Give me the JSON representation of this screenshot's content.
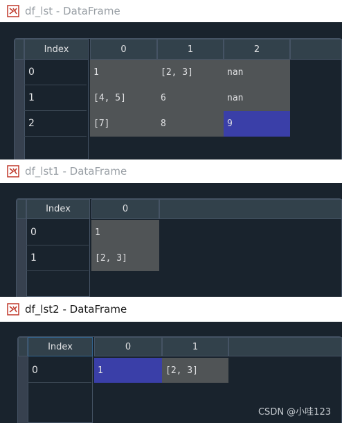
{
  "windows": [
    {
      "title": "df_lst - DataFrame",
      "index_header": "Index",
      "columns": [
        "0",
        "1",
        "2"
      ],
      "rows": [
        {
          "index": "0",
          "cells": [
            "1",
            "[2, 3]",
            "nan"
          ]
        },
        {
          "index": "1",
          "cells": [
            "[4, 5]",
            "6",
            "nan"
          ]
        },
        {
          "index": "2",
          "cells": [
            "[7]",
            "8",
            "9"
          ]
        }
      ],
      "selected_cell": "row 2, column 2"
    },
    {
      "title": "df_lst1 - DataFrame",
      "index_header": "Index",
      "columns": [
        "0"
      ],
      "rows": [
        {
          "index": "0",
          "cells": [
            "1"
          ]
        },
        {
          "index": "1",
          "cells": [
            "[2, 3]"
          ]
        }
      ]
    },
    {
      "title": "df_lst2 - DataFrame",
      "index_header": "Index",
      "columns": [
        "0",
        "1"
      ],
      "rows": [
        {
          "index": "0",
          "cells": [
            "1",
            "[2, 3]"
          ]
        }
      ],
      "selected_cell": "row 0, column 0"
    }
  ],
  "watermark": "CSDN @小哇123",
  "colors": {
    "background": "#19232d",
    "header": "#32414b",
    "cell": "#505456",
    "selection": "#3a3fa8",
    "titlebar": "#ffffff"
  },
  "icons": [
    "dataframe-icon"
  ]
}
